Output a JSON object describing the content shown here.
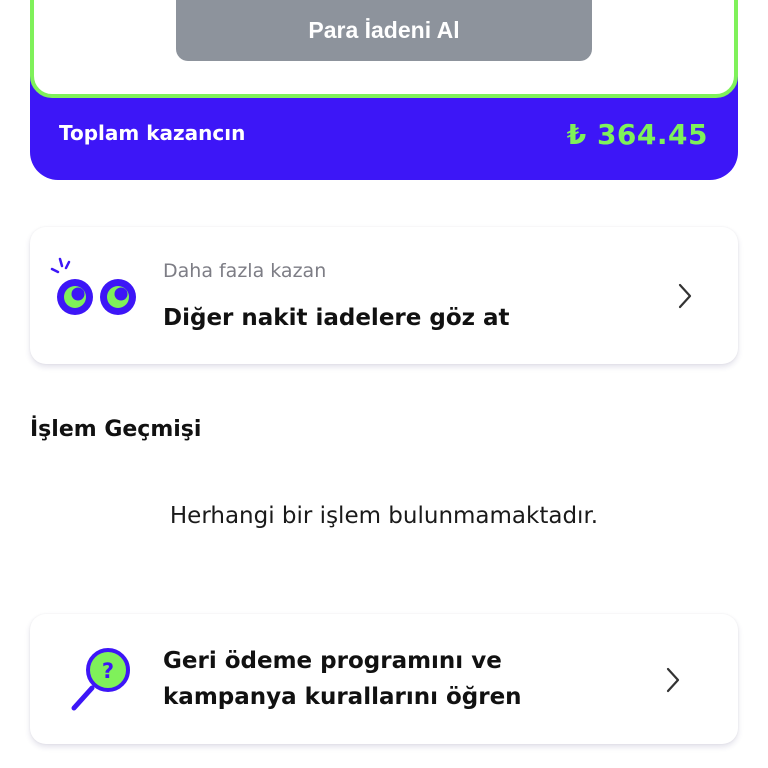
{
  "cashback": {
    "claim_button_label": "Para İadeni Al",
    "total_label": "Toplam kazancın",
    "total_value": "₺ 364.45"
  },
  "more_offers": {
    "subtitle": "Daha fazla kazan",
    "title": "Diğer nakit iadelere göz at",
    "icon": "eyes-icon"
  },
  "history": {
    "section_title": "İşlem Geçmişi",
    "empty_message": "Herhangi bir işlem bulunmamaktadır."
  },
  "rules": {
    "title_line1": "Geri ödeme programını ve",
    "title_line2": "kampanya kurallarını öğren",
    "icon": "magnifier-question-icon"
  },
  "colors": {
    "brand_blue": "#3d16f7",
    "accent_green": "#7ff15a",
    "button_gray": "#8d939c"
  }
}
